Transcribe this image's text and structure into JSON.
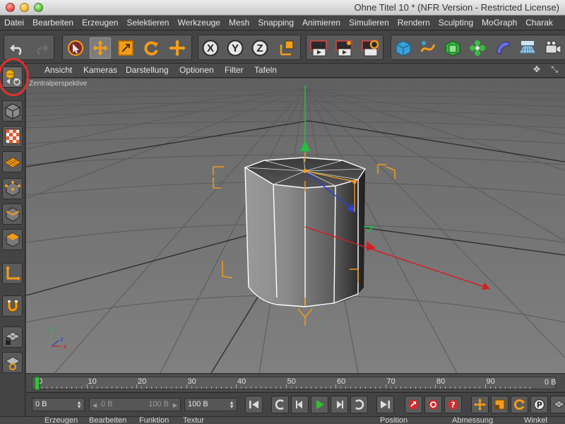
{
  "window": {
    "title": "Ohne Titel 10 * (NFR Version - Restricted License)"
  },
  "menubar": {
    "items": [
      "Datei",
      "Bearbeiten",
      "Erzeugen",
      "Selektieren",
      "Werkzeuge",
      "Mesh",
      "Snapping",
      "Animieren",
      "Simulieren",
      "Rendern",
      "Sculpting",
      "MoGraph",
      "Charak"
    ]
  },
  "toolbar": {
    "axis_x": "X",
    "axis_y": "Y",
    "axis_z": "Z"
  },
  "viewport": {
    "menu": [
      "Ansicht",
      "Kameras",
      "Darstellung",
      "Optionen",
      "Filter",
      "Tafeln"
    ],
    "label": "Zentralperspektive",
    "axis_x": "x",
    "axis_y": "y",
    "axis_z": "z"
  },
  "timeline": {
    "ticks": [
      "0",
      "10",
      "20",
      "30",
      "40",
      "50",
      "60",
      "70",
      "80",
      "90"
    ],
    "current_frame": 0,
    "max_frame": 100,
    "end_label": "0 B"
  },
  "transport": {
    "start_field": "0 B",
    "range_min": "0 B",
    "range_max": "100 B",
    "end_field": "100 B"
  },
  "bottom": {
    "left_tabs": [
      "Erzeugen",
      "Bearbeiten",
      "Funktion",
      "Textur"
    ],
    "right_tabs": [
      "Position",
      "Abmessung",
      "Winkel"
    ]
  },
  "colors": {
    "accent": "#f39c19",
    "highlight_ring": "#e03030",
    "axis_x": "#d42020",
    "axis_y": "#20c040",
    "axis_z": "#3040d0",
    "playhead": "#37c337"
  }
}
